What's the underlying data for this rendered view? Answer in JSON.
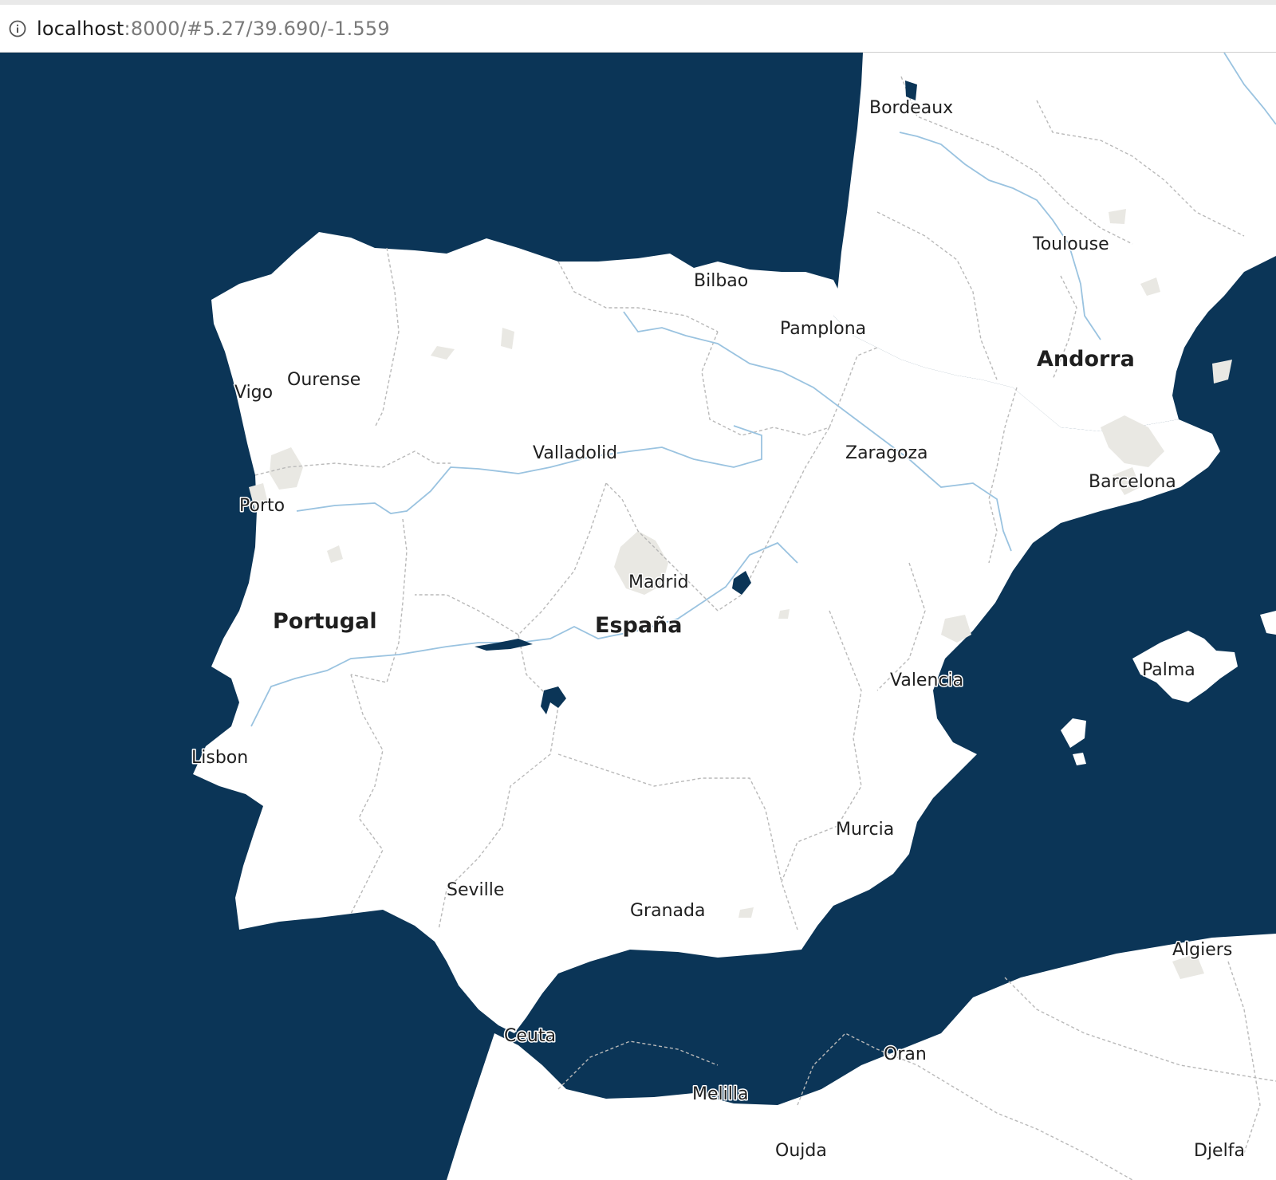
{
  "browser": {
    "url_host": "localhost",
    "url_rest": ":8000/#5.27/39.690/-1.559",
    "info_icon": "info-circle-icon"
  },
  "map": {
    "colors": {
      "water": "#0b3557",
      "land": "#ffffff",
      "urban": "#e9e8e3",
      "border": "#b9b9b9",
      "river": "#9ac3e0",
      "label": "#1f1f1f"
    },
    "countries": {
      "portugal": "Portugal",
      "spain": "España",
      "andorra": "Andorra"
    },
    "cities": {
      "bordeaux": "Bordeaux",
      "toulouse": "Toulouse",
      "bilbao": "Bilbao",
      "pamplona": "Pamplona",
      "ourense": "Ourense",
      "vigo": "Vigo",
      "valladolid": "Valladolid",
      "zaragoza": "Zaragoza",
      "barcelona": "Barcelona",
      "porto": "Porto",
      "madrid": "Madrid",
      "valencia": "Valencia",
      "palma": "Palma",
      "lisbon": "Lisbon",
      "murcia": "Murcia",
      "seville": "Seville",
      "granada": "Granada",
      "algiers": "Algiers",
      "ceuta": "Ceuta",
      "oran": "Oran",
      "melilla": "Melilla",
      "oujda": "Oujda",
      "djelfa": "Djelfa"
    }
  }
}
